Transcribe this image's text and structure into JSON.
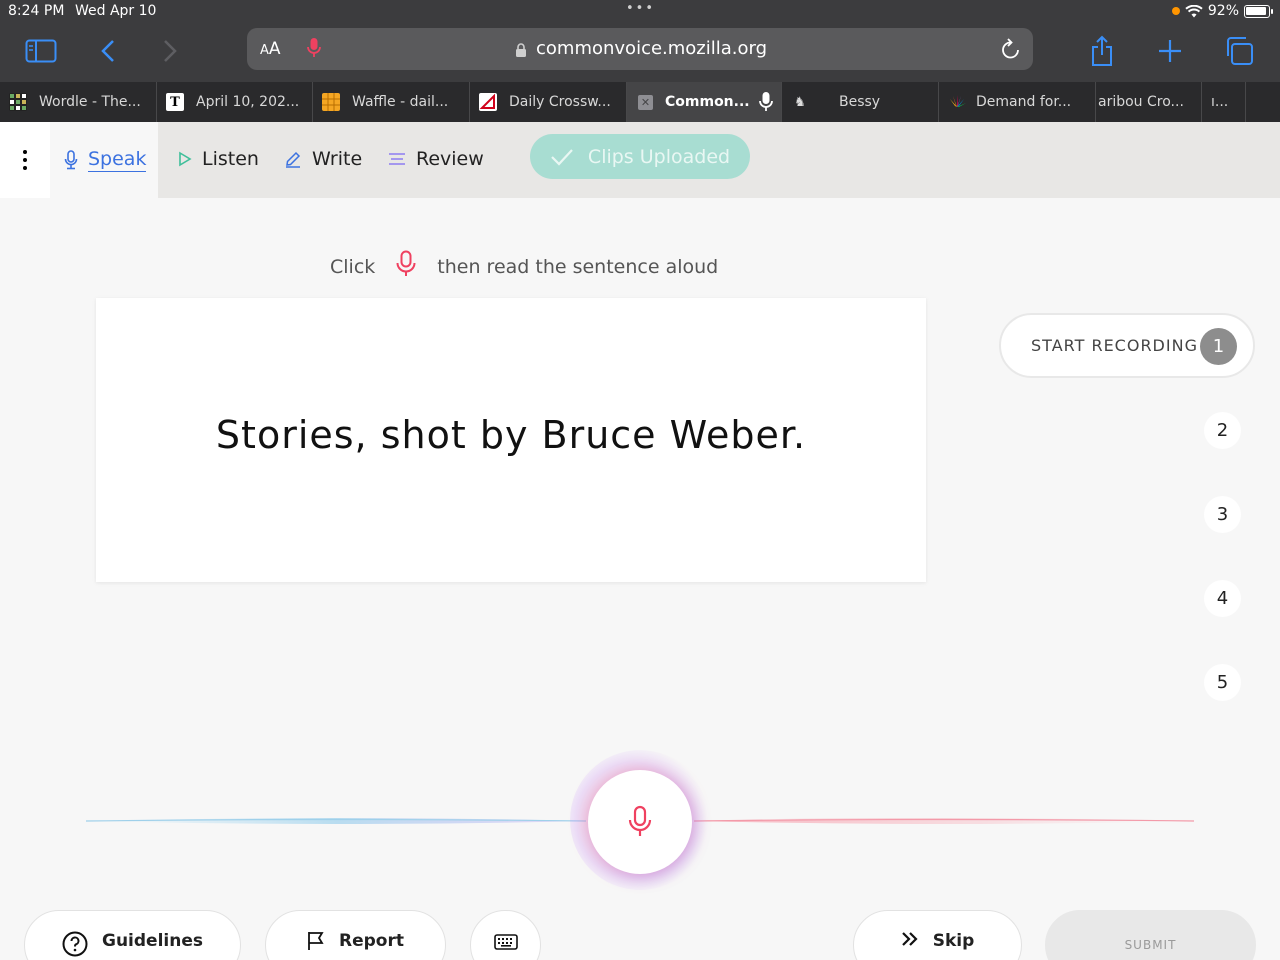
{
  "status_bar": {
    "time": "8:24 PM",
    "date": "Wed Apr 10",
    "battery": "92%"
  },
  "browser": {
    "text_size_label_big": "A",
    "text_size_label_small": "A",
    "url": "commonvoice.mozilla.org",
    "tabs": [
      {
        "label": "Wordle - The...",
        "icon": "wordle-grid-icon"
      },
      {
        "label": "April 10, 202...",
        "icon": "nyt-icon"
      },
      {
        "label": "Waffle - dail...",
        "icon": "waffle-icon"
      },
      {
        "label": "Daily Crossw...",
        "icon": "crossword-icon"
      },
      {
        "label": "Common...",
        "icon": "close-tab-icon",
        "active": true
      },
      {
        "label": "Bessy",
        "icon": "cow-icon"
      },
      {
        "label": "Demand for...",
        "icon": "nbc-peacock-icon"
      },
      {
        "label": "aribou Cro...",
        "icon": ""
      },
      {
        "label": "ı...",
        "icon": ""
      }
    ]
  },
  "nav": {
    "speak": "Speak",
    "listen": "Listen",
    "write": "Write",
    "review": "Review",
    "clips_uploaded": "Clips Uploaded"
  },
  "instruction": {
    "before": "Click",
    "after": "then read the sentence aloud"
  },
  "sentence": "Stories, shot by Bruce Weber.",
  "steps": {
    "start_recording": "START RECORDING",
    "numbers": [
      "1",
      "2",
      "3",
      "4",
      "5"
    ]
  },
  "buttons": {
    "guidelines": "Guidelines",
    "report": "Report",
    "skip": "Skip",
    "submit": "SUBMIT"
  },
  "colors": {
    "accent_blue": "#3c72e0",
    "record_red": "#ef4160",
    "clips_uploaded_bg": "#a8ddd2",
    "listen_green": "#3fbf9a"
  }
}
